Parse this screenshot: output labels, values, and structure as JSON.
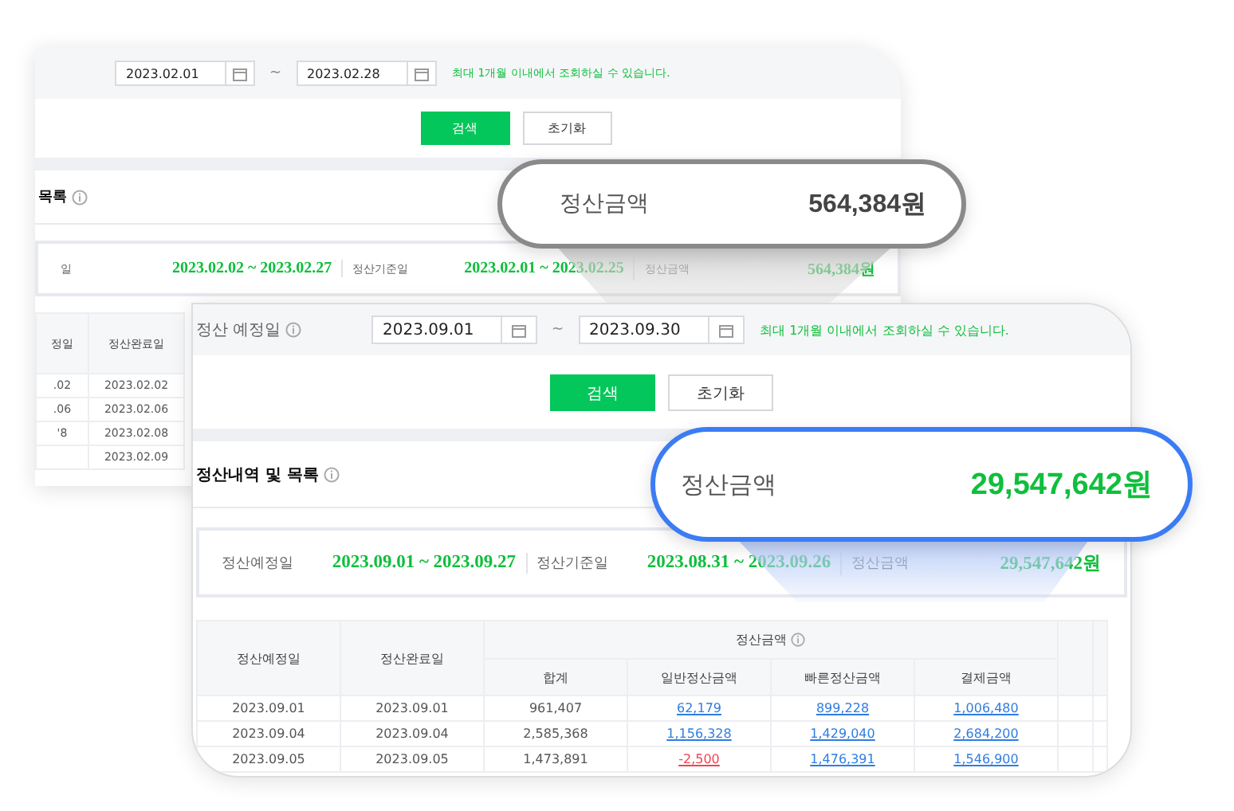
{
  "back_card": {
    "date_from": "2023.02.01",
    "range_sep": "~",
    "date_to": "2023.02.28",
    "hint": "최대 1개월 이내에서 조회하실 수 있습니다.",
    "buttons": [
      {
        "label": "검색",
        "kind": "primary"
      },
      {
        "label": "초기화",
        "kind": "secondary"
      }
    ],
    "section_title": "목록",
    "summary": [
      {
        "label": "일",
        "value": "2023.02.02 ~ 2023.02.27"
      },
      {
        "label": "정산기준일",
        "value": "2023.02.01 ~ 2023.02.25"
      },
      {
        "label": "정산금액",
        "value": "564,384원"
      }
    ],
    "table": {
      "columns": [
        "정일",
        "정산완료일"
      ],
      "rows": [
        {
          "column_1": ".02",
          "column_2": "2023.02.02"
        },
        {
          "column_1": ".06",
          "column_2": "2023.02.06"
        },
        {
          "column_1": "'8",
          "column_2": "2023.02.08"
        },
        {
          "column_2": "2023.02.09"
        }
      ]
    }
  },
  "front_card": {
    "filter_label": "정산 예정일",
    "date_from": "2023.09.01",
    "range_sep": "~",
    "date_to": "2023.09.30",
    "hint": "최대 1개월 이내에서 조회하실 수 있습니다.",
    "buttons": [
      {
        "label": "검색",
        "kind": "primary"
      },
      {
        "label": "초기화",
        "kind": "secondary"
      }
    ],
    "section_title": "정산내역 및 목록",
    "summary": [
      {
        "label": "정산예정일",
        "value": "2023.09.01 ~ 2023.09.27"
      },
      {
        "label": "정산기준일",
        "value": "2023.08.31 ~ 2023.09.26"
      },
      {
        "label": "정산금액",
        "value": "29,547,642원"
      }
    ],
    "table": {
      "columns": [
        "정산예정일",
        "정산완료일"
      ],
      "group": "정산금액",
      "sub_columns": [
        "합계",
        "일반정산금액",
        "빠른정산금액",
        "결제금액"
      ],
      "rows": [
        [
          {
            "text": "2023.09.01",
            "kind": "plain"
          },
          {
            "text": "2023.09.01",
            "kind": "plain"
          },
          {
            "text": "961,407",
            "kind": "plain"
          },
          {
            "text": "62,179",
            "kind": "link"
          },
          {
            "text": "899,228",
            "kind": "link"
          },
          {
            "text": "1,006,480",
            "kind": "link"
          }
        ],
        [
          {
            "text": "2023.09.04",
            "kind": "plain"
          },
          {
            "text": "2023.09.04",
            "kind": "plain"
          },
          {
            "text": "2,585,368",
            "kind": "plain"
          },
          {
            "text": "1,156,328",
            "kind": "link"
          },
          {
            "text": "1,429,040",
            "kind": "link"
          },
          {
            "text": "2,684,200",
            "kind": "link"
          }
        ],
        [
          {
            "text": "2023.09.05",
            "kind": "plain"
          },
          {
            "text": "2023.09.05",
            "kind": "plain"
          },
          {
            "text": "1,473,891",
            "kind": "plain"
          },
          {
            "text": "-2,500",
            "kind": "negative"
          },
          {
            "text": "1,476,391",
            "kind": "link"
          },
          {
            "text": "1,546,900",
            "kind": "link"
          }
        ]
      ]
    }
  },
  "callouts": [
    {
      "label": "정산금액",
      "value": "564,384원",
      "kind": "muted"
    },
    {
      "label": "정산금액",
      "value": "29,547,642원",
      "kind": "highlight"
    }
  ]
}
